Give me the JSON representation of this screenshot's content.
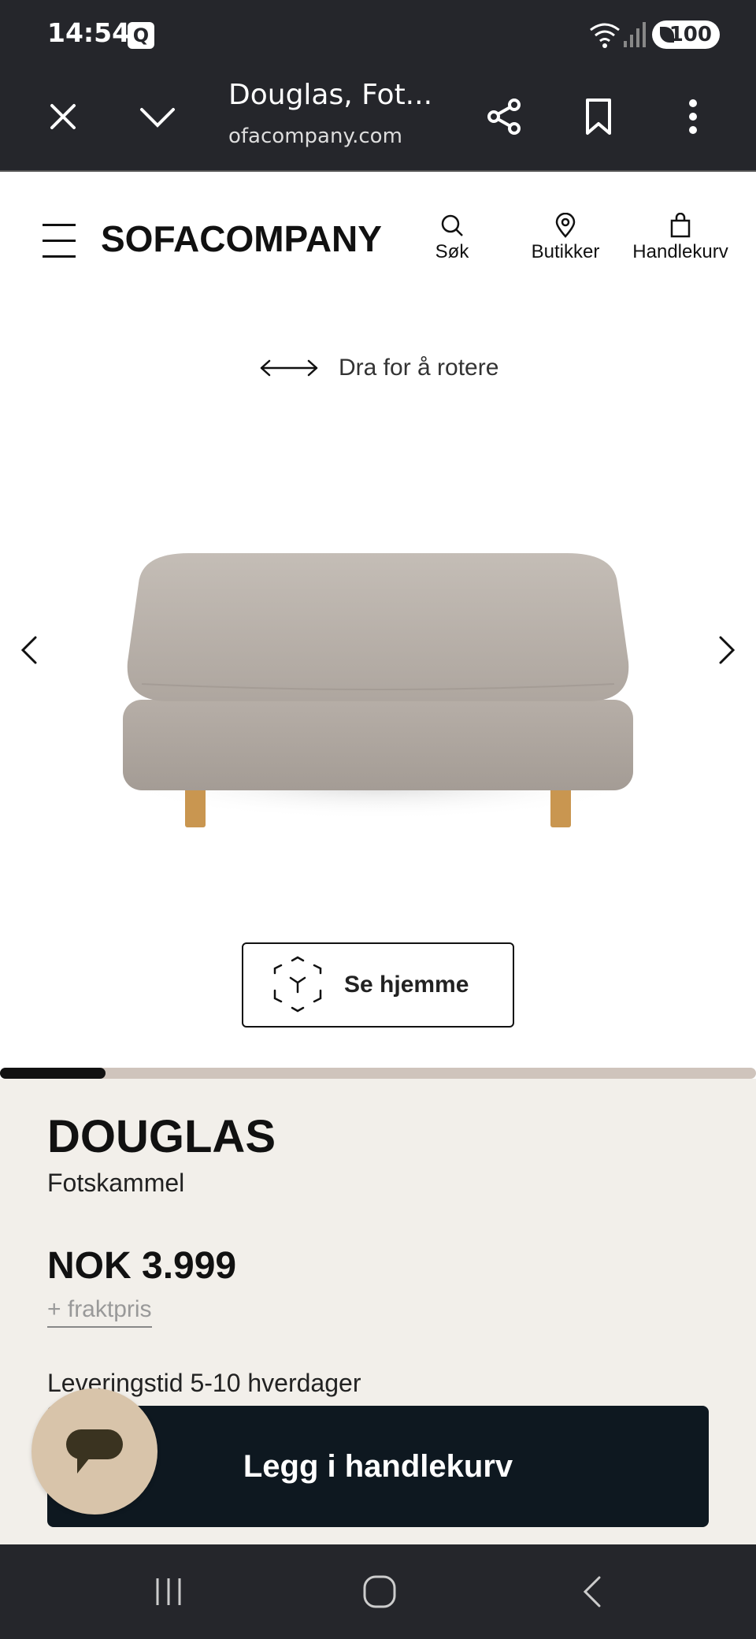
{
  "status_bar": {
    "time": "14:54",
    "app_badge": "Q",
    "battery": "100"
  },
  "browser": {
    "title": "Douglas, Fot...",
    "url": "ofacompany.com",
    "icons": [
      "close-icon",
      "chevron-down-icon",
      "share-icon",
      "bookmark-icon",
      "more-vert-icon"
    ]
  },
  "header": {
    "logo": "SOFACOMPANY",
    "search_label": "Søk",
    "stores_label": "Butikker",
    "cart_label": "Handlekurv"
  },
  "hero": {
    "rotate_hint": "Dra for å rotere",
    "see_home_label": "Se hjemme",
    "image_progress": 0.14
  },
  "product": {
    "name": "DOUGLAS",
    "subtitle": "Fotskammel",
    "price": "NOK 3.999",
    "freight": "+ fraktpris",
    "delivery": "Leveringstid 5-10 hverdager",
    "add_to_cart": "Legg i handlekurv"
  },
  "colors": {
    "dark_chrome": "#25262b",
    "panel_bg": "#f2efea",
    "cta_bg": "#0e1820",
    "chat_bg": "#d8c4aa",
    "progress_track": "#cfc4bc",
    "fabric": "#b8b0a9",
    "wood": "#c99650"
  }
}
